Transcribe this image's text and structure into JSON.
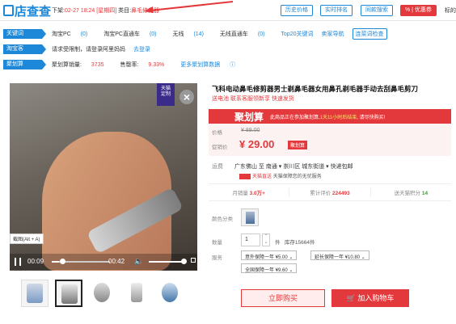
{
  "header": {
    "logo_text": "店查查",
    "shelf_label": "下架:",
    "shelf_time": "02-27 18:24",
    "shelf_weekday": "[星期四]",
    "category_label": "类目:",
    "category": "鼻毛修剪器",
    "buttons": {
      "history_price": "历史价格",
      "realtime_rank": "实时排名",
      "same_search": "同款搜索",
      "coupon": "% | 优惠券",
      "mark": "标的"
    }
  },
  "rows": {
    "keywords": {
      "tag": "关键词",
      "items": [
        {
          "label": "淘宝PC",
          "value": "(0)"
        },
        {
          "label": "淘宝PC直通车",
          "value": "(0)"
        },
        {
          "label": "无线",
          "value": "(14)"
        },
        {
          "label": "无线直通车",
          "value": "(0)"
        }
      ],
      "link1": "Top20关键词",
      "link2": "卖家导航",
      "link3": "连菜词检查"
    },
    "taobaoke": {
      "tag": "淘宝客",
      "text": "请求受限制，请登录阿里妈妈",
      "link": "去登录"
    },
    "juhuasuan": {
      "tag": "聚划算",
      "sales_label": "聚划算销量:",
      "sales_value": "3735",
      "rate_label": "售罄率:",
      "rate_value": "9.33%",
      "more_link": "更多聚划算数据"
    }
  },
  "video": {
    "badge_line1": "天猫",
    "badge_line2": "定制",
    "close": "×",
    "snapshot_hint": "截图(Alt + A)",
    "current_time": "00:09",
    "total_time": "00:42",
    "progress": 0.12,
    "volume": 0.9
  },
  "product": {
    "title": "飞科电动鼻毛修剪器男士剃鼻毛器女用鼻孔剃毛器手动去刮鼻毛剪刀",
    "subtitle": "送电池 联系客服领新享 快速发货",
    "promo_title": "聚划算",
    "promo_note_pre": "此商品正在参加聚划算,",
    "promo_note_hl": "1天11小时后结束",
    "promo_note_post": ", 请尽快购买!",
    "price_label": "价格",
    "orig_price": "¥ 89.00",
    "promo_label": "促销价",
    "promo_price": "¥ 29.00",
    "promo_tag": "聚划算",
    "shipping_label": "运费",
    "shipping_text": "广东佛山  至  南通 ▾ 崇川区  城东街道 ▾  快递包邮",
    "service_text": "天猫保障您的无忧服务",
    "service_badge": "天猫直送",
    "stats": {
      "monthly_label": "月销量",
      "monthly_value": "3.0万+",
      "reviews_label": "累计评价",
      "reviews_value": "224493",
      "points_label": "送天猫积分",
      "points_value": "14"
    },
    "color_label": "颜色分类",
    "qty_label": "数量",
    "qty_value": "1",
    "qty_unit": "件",
    "stock": "库存15664件",
    "service_label": "服务",
    "options": [
      "意外保障一年 ¥5.00 ⌄",
      "延长保障一年 ¥10.80 ⌄",
      "全国保障一年 ¥9.60 ⌄"
    ],
    "buy_label": "立即购买",
    "cart_label": "加入购物车"
  }
}
